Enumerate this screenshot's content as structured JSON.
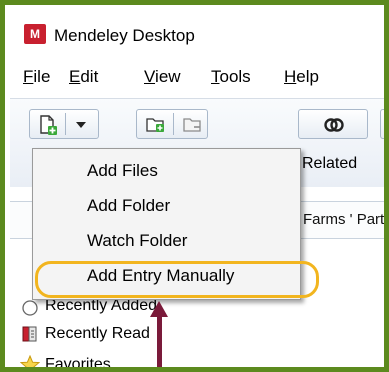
{
  "window": {
    "title": "Mendeley Desktop",
    "logo_text": "M"
  },
  "menubar": {
    "items": [
      {
        "label": "File",
        "mnemonic": "F",
        "rest": "ile"
      },
      {
        "label": "Edit",
        "mnemonic": "E",
        "rest": "dit"
      },
      {
        "label": "View",
        "mnemonic": "V",
        "rest": "iew"
      },
      {
        "label": "Tools",
        "mnemonic": "T",
        "rest": "ools"
      },
      {
        "label": "Help",
        "mnemonic": "H",
        "rest": "elp"
      }
    ]
  },
  "toolbar": {
    "related_label": "Related"
  },
  "content": {
    "column_text": "Farms ' Part"
  },
  "sidebar": {
    "items": [
      {
        "label": "Recently Added",
        "icon": "clock-icon"
      },
      {
        "label": "Recently Read",
        "icon": "book-icon"
      },
      {
        "label": "Favorites",
        "icon": "star-icon"
      }
    ]
  },
  "dropdown": {
    "items": [
      {
        "label": "Add Files"
      },
      {
        "label": "Add Folder"
      },
      {
        "label": "Watch Folder"
      },
      {
        "label": "Add Entry Manually"
      }
    ]
  },
  "colors": {
    "frame_border": "#5c8a1e",
    "highlight_ring": "#f2b51f",
    "arrow": "#7a1a3a",
    "logo": "#c8202f"
  }
}
